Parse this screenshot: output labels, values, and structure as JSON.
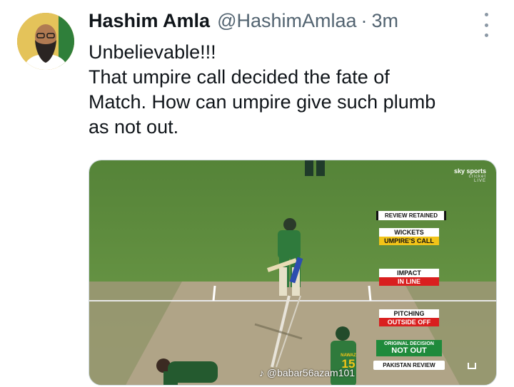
{
  "tweet": {
    "author_name": "Hashim Amla",
    "handle": "@HashimAmlaa",
    "separator": "·",
    "time": "3m",
    "text_lines": [
      "Unbelievable!!!",
      "That umpire call decided the fate of",
      "Match. How can umpire give such plumb",
      "as not out."
    ]
  },
  "media": {
    "broadcaster": "sky sports",
    "broadcaster_sub": "cricket",
    "broadcaster_live": "LIVE",
    "drs": {
      "review_status": "REVIEW RETAINED",
      "wickets_label": "WICKETS",
      "wickets_value": "UMPIRE'S CALL",
      "impact_label": "IMPACT",
      "impact_value": "IN LINE",
      "pitching_label": "PITCHING",
      "pitching_value": "OUTSIDE OFF",
      "original_label": "ORIGINAL DECISION",
      "original_value": "NOT OUT",
      "review_team": "PAKISTAN REVIEW"
    },
    "jersey_name": "NAWAZ",
    "jersey_number": "15",
    "watermark": "@babar56azam101",
    "colors": {
      "field": "#5f8f3b",
      "pitch": "#a89d82",
      "umpires_call": "#f2c418",
      "drs_red": "#d91f1f",
      "decision_green": "#1f8a3b"
    }
  },
  "icons": {
    "more": "more-vertical-icon",
    "tiktok": "tiktok-icon",
    "expand": "expand-icon"
  }
}
